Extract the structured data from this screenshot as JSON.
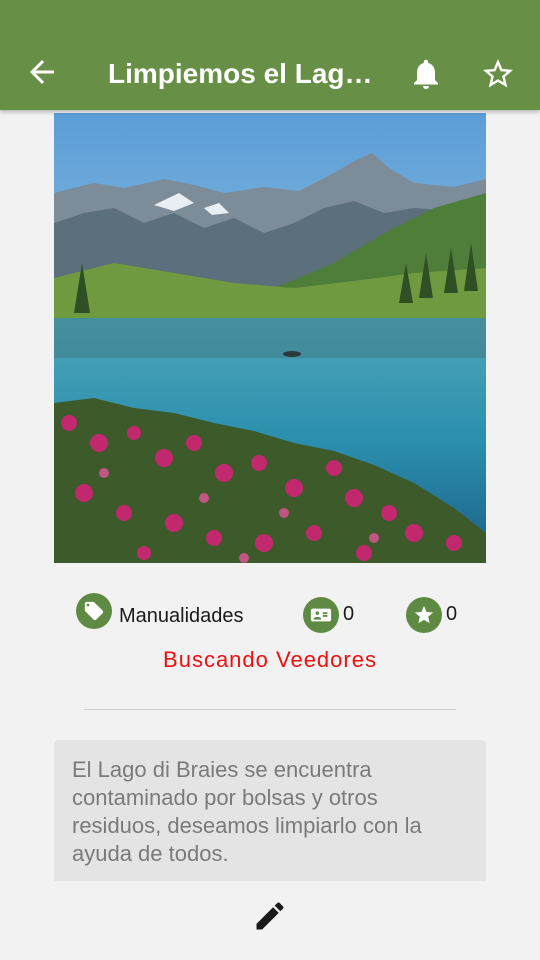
{
  "appbar": {
    "title": "Limpiemos el Lago di Braies",
    "back_icon": "arrow-back-icon",
    "bell_icon": "bell-icon",
    "star_icon": "star-outline-icon"
  },
  "hero": {
    "image": "mountain-lake-photo"
  },
  "stats": {
    "category_label": "Manualidades",
    "category_icon": "tag-icon",
    "viewers_count": "0",
    "viewers_icon": "contact-card-icon",
    "favorites_count": "0",
    "favorites_icon": "star-icon"
  },
  "status_text": "Buscando Veedores",
  "description": "El Lago di Braies se encuentra contaminado por bolsas y otros residuos, deseamos limpiarlo con la ayuda de todos.",
  "edit_icon": "pencil-icon",
  "colors": {
    "appbar": "#678f46",
    "accent": "#5f8a43",
    "status": "#ee1010"
  }
}
